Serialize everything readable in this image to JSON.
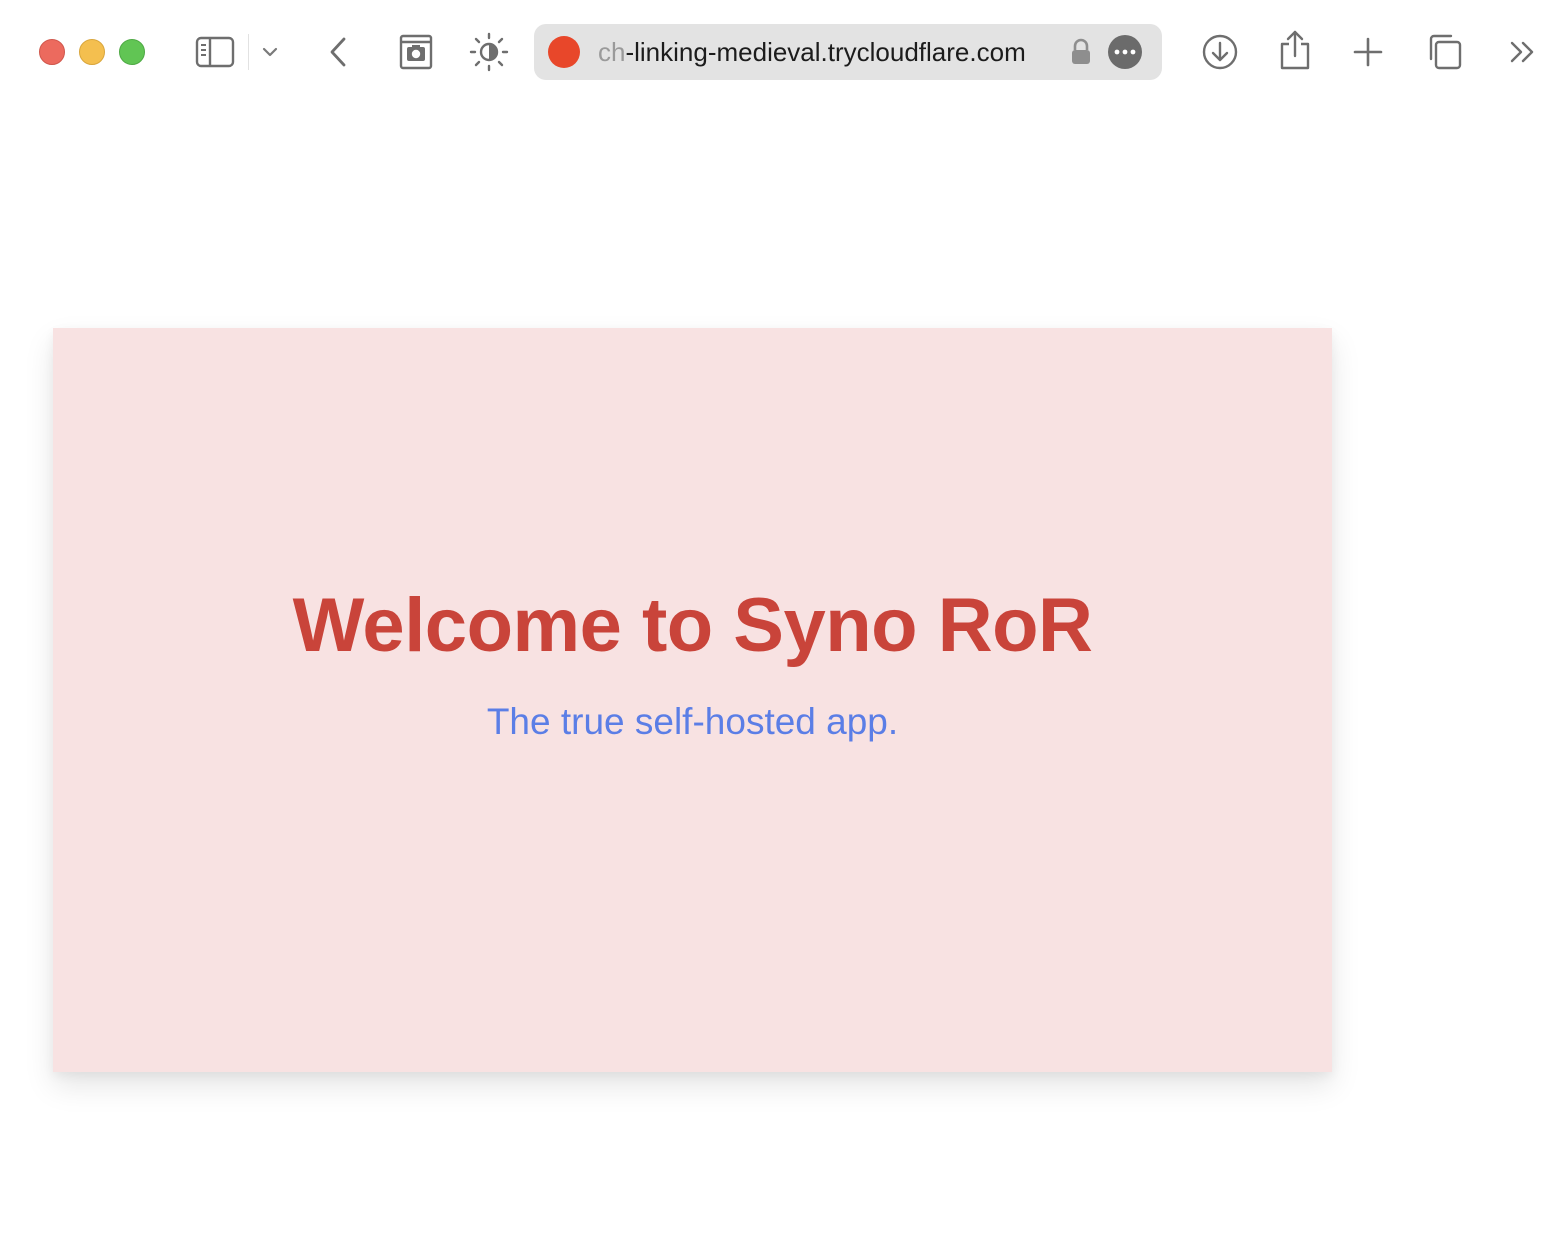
{
  "browser": {
    "url_dim": "ch",
    "url_main": "-linking-medieval.trycloudflare.com",
    "icons": {
      "sidebar": "sidebar-icon",
      "chevron": "chevron-down-icon",
      "back": "chevron-left-icon",
      "screenshot": "camera-icon",
      "appearance": "brightness-icon",
      "lock": "lock-icon",
      "more": "ellipsis-icon",
      "download": "download-icon",
      "share": "share-icon",
      "new_tab": "plus-icon",
      "tabs": "tabs-overview-icon",
      "overflow": "double-chevron-right-icon"
    },
    "favicon_color": "#e8472a"
  },
  "page": {
    "title": "Welcome to Syno RoR",
    "subtitle": "The true self-hosted app.",
    "colors": {
      "card_bg": "#f8e2e2",
      "title": "#c9443a",
      "subtitle": "#5b7ee6"
    }
  }
}
